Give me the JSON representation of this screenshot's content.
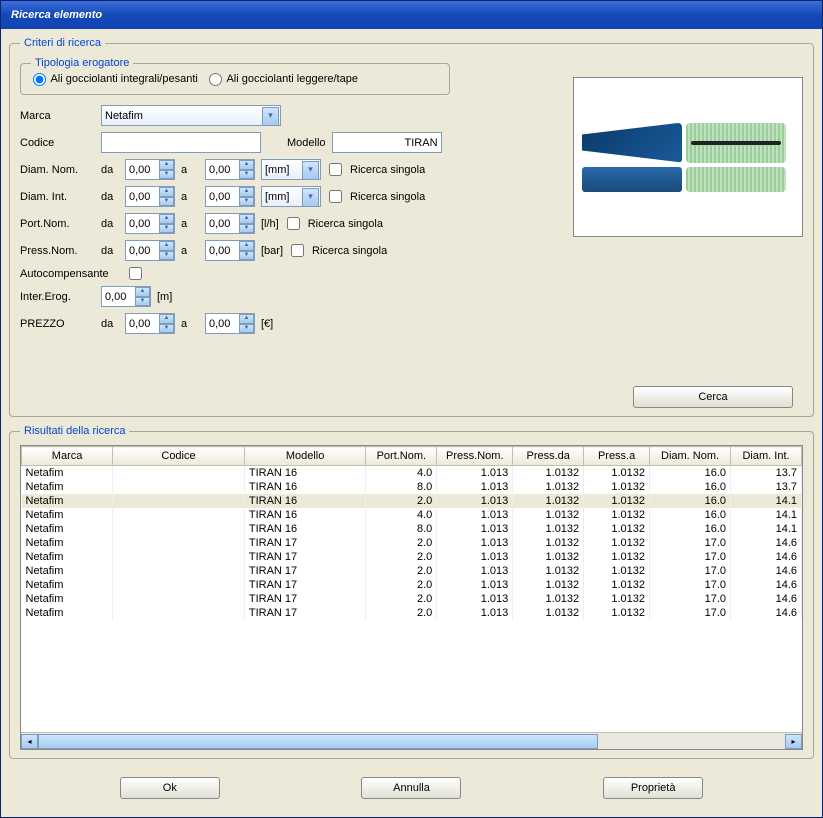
{
  "window": {
    "title": "Ricerca elemento"
  },
  "criteria": {
    "legend": "Criteri di ricerca",
    "tipologia": {
      "legend": "Tipologia erogatore",
      "opt1": "Ali gocciolanti integrali/pesanti",
      "opt2": "Ali gocciolanti leggere/tape"
    },
    "marca_label": "Marca",
    "marca_value": "Netafim",
    "codice_label": "Codice",
    "codice_value": "",
    "modello_label": "Modello",
    "modello_value": "TIRAN",
    "diam_nom_label": "Diam. Nom.",
    "diam_int_label": "Diam. Int.",
    "port_nom_label": "Port.Nom.",
    "press_nom_label": "Press.Nom.",
    "da": "da",
    "a": "a",
    "zero": "0,00",
    "unit_mm": "[mm]",
    "unit_lh": "[l/h]",
    "unit_bar": "[bar]",
    "unit_m": "[m]",
    "unit_eur": "[€]",
    "ricerca_singola": "Ricerca singola",
    "autocomp_label": "Autocompensante",
    "inter_erog_label": "Inter.Erog.",
    "prezzo_label": "PREZZO",
    "cerca_btn": "Cerca"
  },
  "results": {
    "legend": "Risultati della ricerca",
    "headers": {
      "marca": "Marca",
      "codice": "Codice",
      "modello": "Modello",
      "port_nom": "Port.Nom.",
      "press_nom": "Press.Nom.",
      "press_da": "Press.da",
      "press_a": "Press.a",
      "diam_nom": "Diam. Nom.",
      "diam_int": "Diam. Int."
    },
    "rows": [
      {
        "marca": "Netafim",
        "codice": "",
        "modello": "TIRAN 16",
        "port": "4.0",
        "pnom": "1.013",
        "pda": "1.0132",
        "pa": "1.0132",
        "dn": "16.0",
        "di": "13.7"
      },
      {
        "marca": "Netafim",
        "codice": "",
        "modello": "TIRAN 16",
        "port": "8.0",
        "pnom": "1.013",
        "pda": "1.0132",
        "pa": "1.0132",
        "dn": "16.0",
        "di": "13.7"
      },
      {
        "marca": "Netafim",
        "codice": "",
        "modello": "TIRAN 16",
        "port": "2.0",
        "pnom": "1.013",
        "pda": "1.0132",
        "pa": "1.0132",
        "dn": "16.0",
        "di": "14.1",
        "selected": true
      },
      {
        "marca": "Netafim",
        "codice": "",
        "modello": "TIRAN 16",
        "port": "4.0",
        "pnom": "1.013",
        "pda": "1.0132",
        "pa": "1.0132",
        "dn": "16.0",
        "di": "14.1"
      },
      {
        "marca": "Netafim",
        "codice": "",
        "modello": "TIRAN 16",
        "port": "8.0",
        "pnom": "1.013",
        "pda": "1.0132",
        "pa": "1.0132",
        "dn": "16.0",
        "di": "14.1"
      },
      {
        "marca": "Netafim",
        "codice": "",
        "modello": "TIRAN 17",
        "port": "2.0",
        "pnom": "1.013",
        "pda": "1.0132",
        "pa": "1.0132",
        "dn": "17.0",
        "di": "14.6"
      },
      {
        "marca": "Netafim",
        "codice": "",
        "modello": "TIRAN 17",
        "port": "2.0",
        "pnom": "1.013",
        "pda": "1.0132",
        "pa": "1.0132",
        "dn": "17.0",
        "di": "14.6"
      },
      {
        "marca": "Netafim",
        "codice": "",
        "modello": "TIRAN 17",
        "port": "2.0",
        "pnom": "1.013",
        "pda": "1.0132",
        "pa": "1.0132",
        "dn": "17.0",
        "di": "14.6"
      },
      {
        "marca": "Netafim",
        "codice": "",
        "modello": "TIRAN 17",
        "port": "2.0",
        "pnom": "1.013",
        "pda": "1.0132",
        "pa": "1.0132",
        "dn": "17.0",
        "di": "14.6"
      },
      {
        "marca": "Netafim",
        "codice": "",
        "modello": "TIRAN 17",
        "port": "2.0",
        "pnom": "1.013",
        "pda": "1.0132",
        "pa": "1.0132",
        "dn": "17.0",
        "di": "14.6"
      },
      {
        "marca": "Netafim",
        "codice": "",
        "modello": "TIRAN 17",
        "port": "2.0",
        "pnom": "1.013",
        "pda": "1.0132",
        "pa": "1.0132",
        "dn": "17.0",
        "di": "14.6"
      }
    ]
  },
  "buttons": {
    "ok": "Ok",
    "annulla": "Annulla",
    "proprieta": "Proprietà"
  }
}
